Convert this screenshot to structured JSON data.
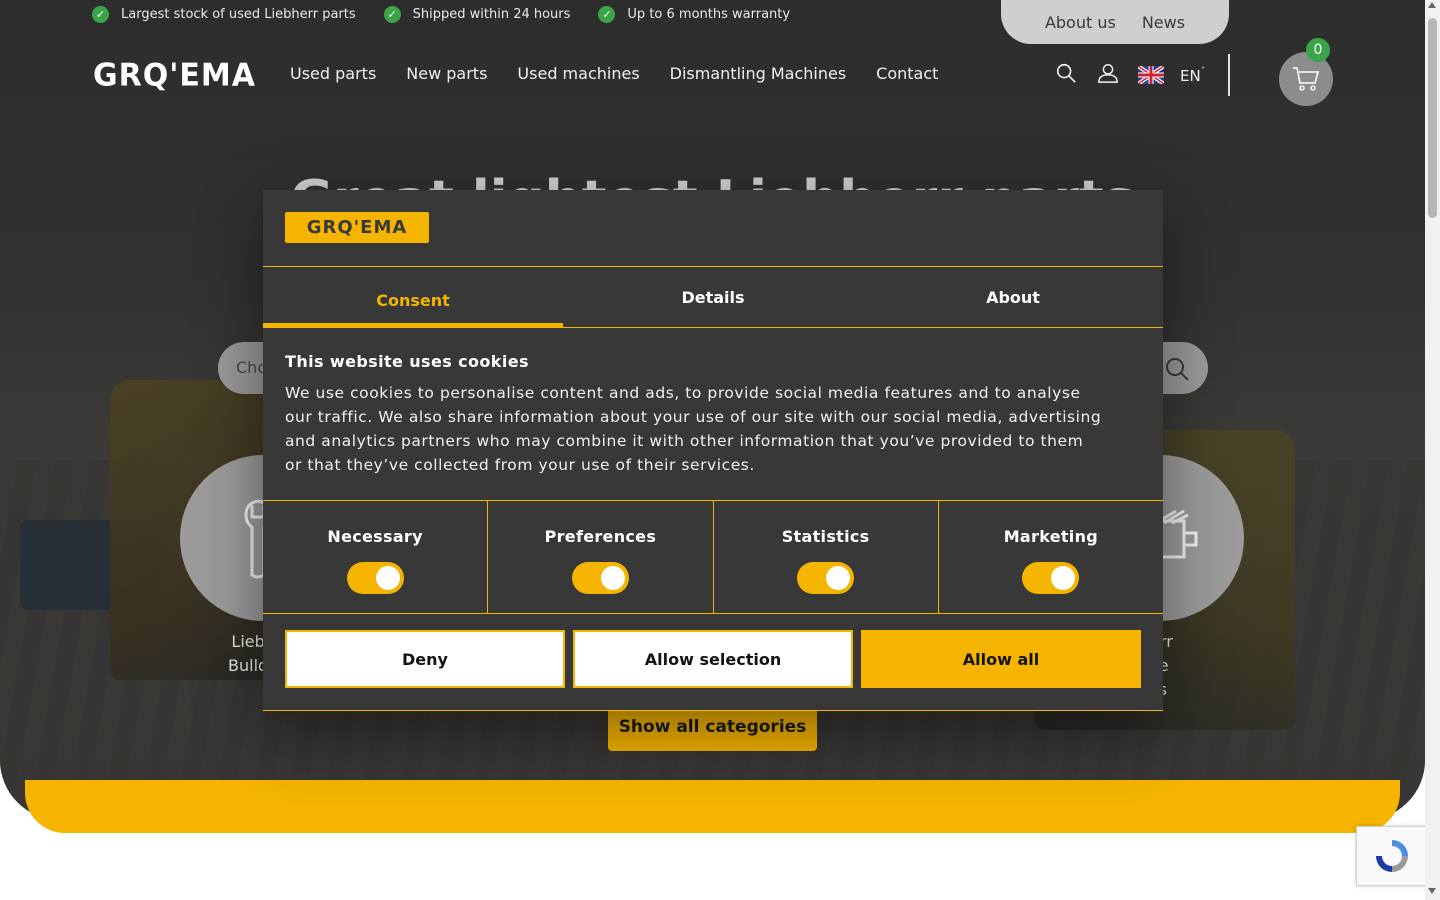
{
  "topbar": {
    "benefits": [
      "Largest stock of used Liebherr parts",
      "Shipped within 24 hours",
      "Up to 6 months warranty"
    ],
    "links": [
      "About us",
      "News"
    ]
  },
  "header": {
    "logo": "GRQ'EMA",
    "nav": [
      "Used parts",
      "New parts",
      "Used machines",
      "Dismantling Machines",
      "Contact"
    ],
    "language": "EN",
    "cart_count": "0"
  },
  "hero": {
    "title": "Great lightest Liebherr parts",
    "search_placeholder": "Cho",
    "categories": [
      {
        "label_line1": "Lieb",
        "label_line2": "Bulld"
      },
      {
        "label_line1": "herr",
        "label_line2": "ine",
        "label_line3": "rts"
      }
    ],
    "show_all_label": "Show all categories"
  },
  "dialog": {
    "logo": "GRQ'EMA",
    "tabs": [
      "Consent",
      "Details",
      "About"
    ],
    "active_tab": "Consent",
    "title": "This website uses cookies",
    "body": "We use cookies to personalise content and ads, to provide social media features and to analyse our traffic. We also share information about your use of our site with our social media, advertising and analytics partners who may combine it with other information that you’ve provided to them or that they’ve collected from your use of their services.",
    "toggles": [
      {
        "label": "Necessary",
        "on": true
      },
      {
        "label": "Preferences",
        "on": true
      },
      {
        "label": "Statistics",
        "on": true
      },
      {
        "label": "Marketing",
        "on": true
      }
    ],
    "buttons": {
      "deny": "Deny",
      "selection": "Allow selection",
      "allow_all": "Allow all"
    }
  },
  "colors": {
    "accent": "#f4b400",
    "dialog_bg": "#383838",
    "success": "#3aa548"
  }
}
